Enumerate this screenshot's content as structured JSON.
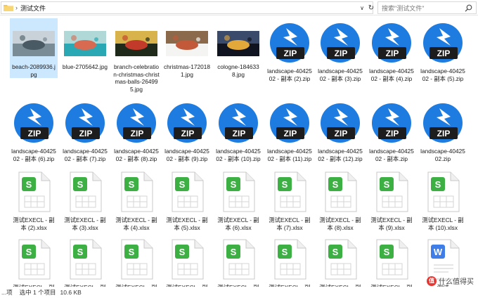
{
  "address": {
    "separator": "›",
    "path": "测试文件",
    "dropdown_glyph": "∨",
    "refresh_glyph": "↻"
  },
  "search": {
    "placeholder": "搜索\"测试文件\"",
    "icon": "search-icon"
  },
  "rows": [
    [
      {
        "kind": "image",
        "label": "beach-2089936.jpg",
        "selected": true,
        "palette": [
          "#7a8c96",
          "#4a5a64",
          "#c8d2d8"
        ]
      },
      {
        "kind": "image",
        "label": "blue-2705642.jpg",
        "palette": [
          "#2aa9b5",
          "#d96a52",
          "#b0d8d6"
        ]
      },
      {
        "kind": "image",
        "label": "branch-celebration-christmas-christmas-balls-264995.jpg",
        "palette": [
          "#1f2a1a",
          "#c23a2a",
          "#d8b24a"
        ]
      },
      {
        "kind": "image",
        "label": "christmas-1720181.jpg",
        "palette": [
          "#f4f4f2",
          "#c25a3a",
          "#8a6a4a"
        ]
      },
      {
        "kind": "image",
        "label": "cologne-1846338.jpg",
        "palette": [
          "#0f1420",
          "#e3a83a",
          "#3a4a6a"
        ]
      },
      {
        "kind": "zip",
        "label": "landscape-4042502 - 副本 (2).zip"
      },
      {
        "kind": "zip",
        "label": "landscape-4042502 - 副本 (3).zip"
      },
      {
        "kind": "zip",
        "label": "landscape-4042502 - 副本 (4).zip"
      },
      {
        "kind": "zip",
        "label": "landscape-4042502 - 副本 (5).zip"
      }
    ],
    [
      {
        "kind": "zip",
        "label": "landscape-4042502 - 副本 (6).zip"
      },
      {
        "kind": "zip",
        "label": "landscape-4042502 - 副本 (7).zip"
      },
      {
        "kind": "zip",
        "label": "landscape-4042502 - 副本 (8).zip"
      },
      {
        "kind": "zip",
        "label": "landscape-4042502 - 副本 (9).zip"
      },
      {
        "kind": "zip",
        "label": "landscape-4042502 - 副本 (10).zip"
      },
      {
        "kind": "zip",
        "label": "landscape-4042502 - 副本 (11).zip"
      },
      {
        "kind": "zip",
        "label": "landscape-4042502 - 副本 (12).zip"
      },
      {
        "kind": "zip",
        "label": "landscape-4042502 - 副本.zip"
      },
      {
        "kind": "zip",
        "label": "landscape-4042502.zip"
      }
    ],
    [
      {
        "kind": "xlsx",
        "label": "测试EXECL - 副本 (2).xlsx"
      },
      {
        "kind": "xlsx",
        "label": "测试EXECL - 副本 (3).xlsx"
      },
      {
        "kind": "xlsx",
        "label": "测试EXECL - 副本 (4).xlsx"
      },
      {
        "kind": "xlsx",
        "label": "测试EXECL - 副本 (5).xlsx"
      },
      {
        "kind": "xlsx",
        "label": "测试EXECL - 副本 (6).xlsx"
      },
      {
        "kind": "xlsx",
        "label": "测试EXECL - 副本 (7).xlsx"
      },
      {
        "kind": "xlsx",
        "label": "测试EXECL - 副本 (8).xlsx"
      },
      {
        "kind": "xlsx",
        "label": "测试EXECL - 副本 (9).xlsx"
      },
      {
        "kind": "xlsx",
        "label": "测试EXECL - 副本 (10).xlsx"
      }
    ],
    [
      {
        "kind": "xlsx",
        "label": "测试EXECL - 副"
      },
      {
        "kind": "xlsx",
        "label": "测试EXECL - 副"
      },
      {
        "kind": "xlsx",
        "label": "测试EXECL - 副"
      },
      {
        "kind": "xlsx",
        "label": "测试EXECL - 副"
      },
      {
        "kind": "xlsx",
        "label": "测试EXECL - 副"
      },
      {
        "kind": "xlsx",
        "label": "测试EXECL - 副"
      },
      {
        "kind": "xlsx",
        "label": "测试EXECL - 副"
      },
      {
        "kind": "xlsx",
        "label": "测试EXECL - 副"
      },
      {
        "kind": "docx",
        "label": "测试"
      }
    ]
  ],
  "icon_text": {
    "zip": "ZIP",
    "xlsx": "S",
    "docx": "W"
  },
  "colors": {
    "zip_blue": "#1e7be0",
    "zip_dark": "#1d1d1d",
    "xlsx_green": "#3cb043",
    "docx_blue": "#3f7ee8",
    "selection": "#cce8ff"
  },
  "status": {
    "item_count": "...项",
    "selected": "选中 1 个项目",
    "size": "10.6 KB"
  },
  "watermark": {
    "badge": "值",
    "text": "什么值得买"
  }
}
